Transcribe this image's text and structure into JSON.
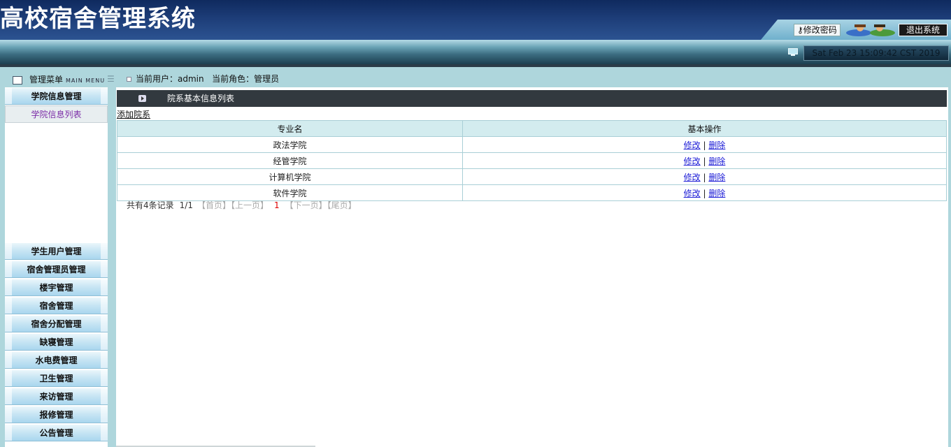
{
  "app": {
    "title": "高校宿舍管理系统"
  },
  "header": {
    "change_password": "修改密码",
    "logout": "退出系统",
    "datetime": "Sat Feb 23 15:09:42 CST 2019"
  },
  "menu_header": {
    "label": "管理菜单",
    "sub": "MAIN MENU"
  },
  "userinfo": {
    "user_label": "当前用户：",
    "user": "admin",
    "role_label": "当前角色：",
    "role": "管理员"
  },
  "sidebar": {
    "active_group": "学院信息管理",
    "active_item": "学院信息列表",
    "groups": [
      "学生用户管理",
      "宿舍管理员管理",
      "楼宇管理",
      "宿舍管理",
      "宿舍分配管理",
      "缺寝管理",
      "水电费管理",
      "卫生管理",
      "来访管理",
      "报修管理",
      "公告管理"
    ]
  },
  "content": {
    "title": "院系基本信息列表",
    "add_link": "添加院系",
    "columns": [
      "专业名",
      "基本操作"
    ],
    "rows": [
      {
        "name": "政法学院",
        "edit": "修改",
        "sep": "|",
        "delete": "删除"
      },
      {
        "name": "经管学院",
        "edit": "修改",
        "sep": "|",
        "delete": "删除"
      },
      {
        "name": "计算机学院",
        "edit": "修改",
        "sep": "|",
        "delete": "删除"
      },
      {
        "name": "软件学院",
        "edit": "修改",
        "sep": "|",
        "delete": "删除"
      }
    ]
  },
  "pager": {
    "total": "共有4条记录",
    "pages": "1/1",
    "first": "【首页】",
    "prev": "【上一页】",
    "current": "1",
    "next": "【下一页】",
    "last": "【尾页】"
  }
}
